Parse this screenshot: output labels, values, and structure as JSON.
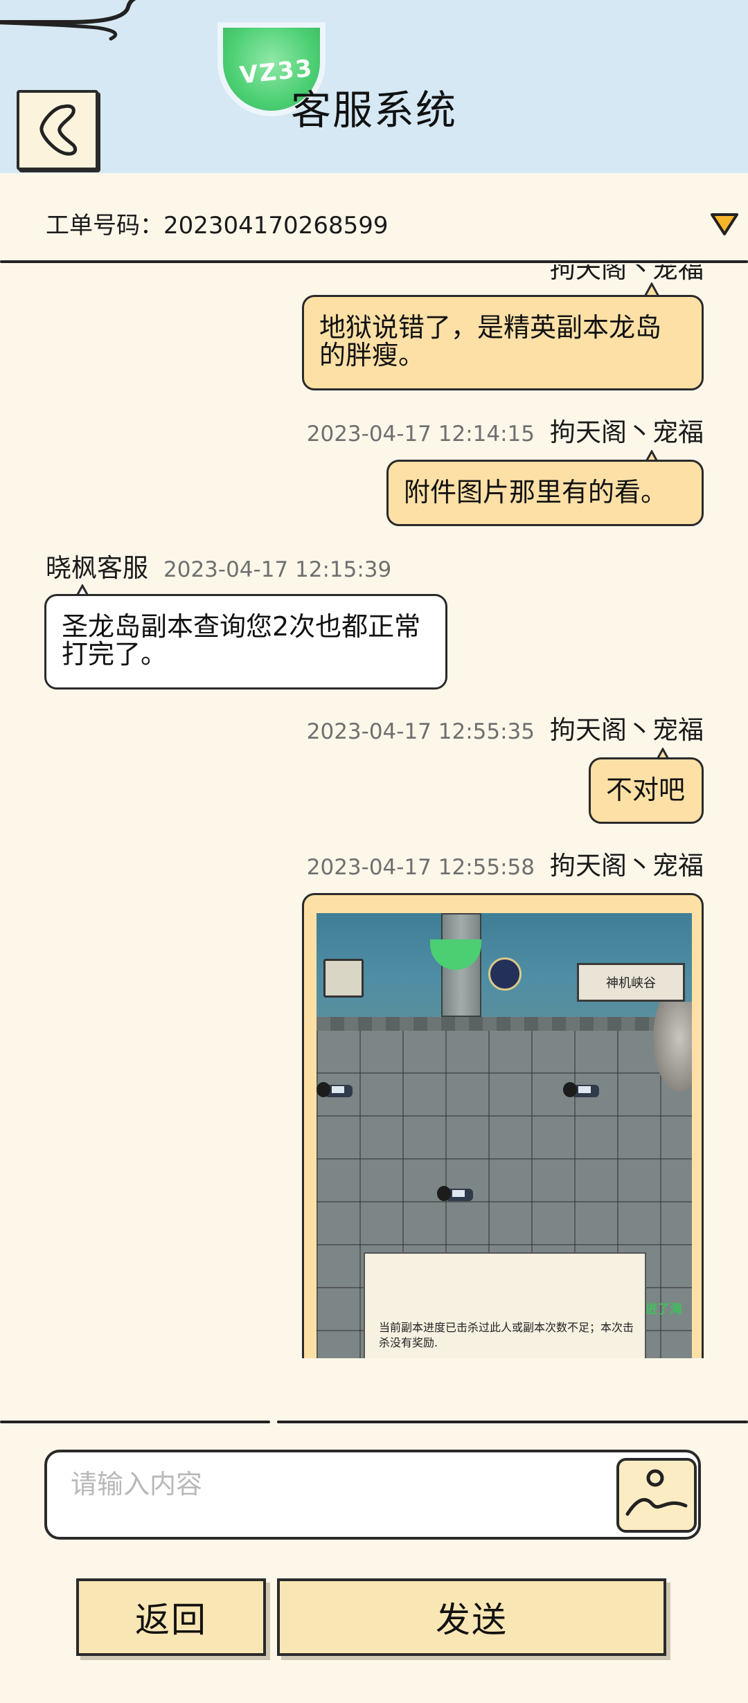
{
  "header": {
    "title": "客服系统",
    "logo_text": "VZ33"
  },
  "ticket": {
    "label": "工单号码：202304170268599"
  },
  "messages": [
    {
      "side": "mine",
      "text": "地狱说错了，是精英副本龙岛的胖瘦。"
    },
    {
      "side": "mine",
      "time": "2023-04-17 12:14:15",
      "sender": "拘天阁丶宠福",
      "text": "附件图片那里有的看。"
    },
    {
      "side": "theirs",
      "time": "2023-04-17 12:15:39",
      "sender": "晓枫客服",
      "text": "圣龙岛副本查询您2次也都正常打完了。"
    },
    {
      "side": "mine",
      "time": "2023-04-17 12:55:35",
      "sender": "拘天阁丶宠福",
      "text": "不对吧"
    },
    {
      "side": "mine",
      "time": "2023-04-17 12:55:58",
      "sender": "拘天阁丶宠福",
      "image": {
        "map_tag": "神机峡谷",
        "side_text": "进了海",
        "dialog_text": "当前副本进度已击杀过此人或副本次数不足；本次击杀没有奖励."
      }
    }
  ],
  "input": {
    "placeholder": "请输入内容",
    "value": ""
  },
  "buttons": {
    "back": "返回",
    "send": "发送"
  },
  "colors": {
    "header_bg": "#d5e8f4",
    "page_bg": "#fdf7ea",
    "my_bubble": "#fde0a6",
    "their_bubble": "#ffffff",
    "button_bg": "#f9e6b5",
    "dropdown_triangle": "#f7b52a"
  },
  "icons": [
    "cloud-decoration-icon",
    "back-arrow-icon",
    "dropdown-triangle-icon",
    "image-upload-icon"
  ]
}
